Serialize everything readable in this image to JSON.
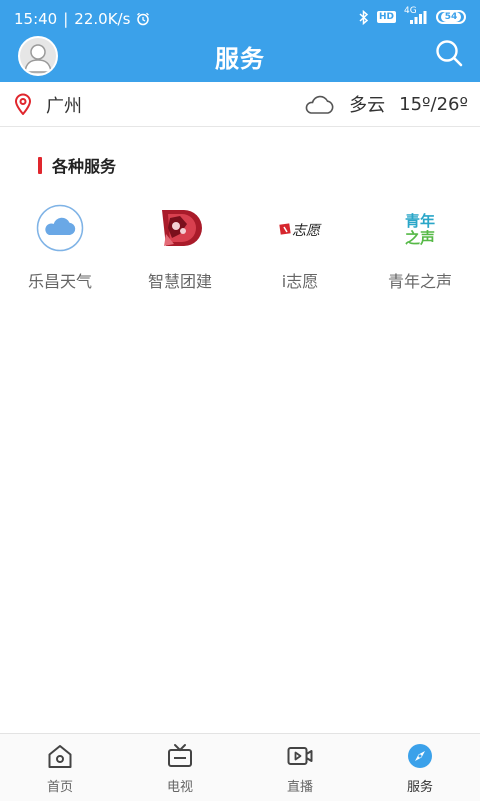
{
  "status_bar": {
    "time": "15:40",
    "separator": "|",
    "net_speed": "22.0K/s",
    "network": "4G",
    "hd_badge": "HD",
    "battery": "54",
    "alarm_icon": "alarm-icon",
    "bluetooth_icon": "bluetooth-icon",
    "signal_icon": "signal-icon"
  },
  "header": {
    "title": "服务",
    "avatar_icon": "user-avatar-icon",
    "search_icon": "search-icon",
    "background_color": "#3ba1ea"
  },
  "location": {
    "city": "广州",
    "location_icon": "location-pin-icon",
    "weather_icon": "cloud-icon",
    "weather": "多云",
    "temperature": "15º/26º"
  },
  "section": {
    "title": "各种服务",
    "accent_color": "#e0262d"
  },
  "services": [
    {
      "label": "乐昌天气",
      "icon": "weather-cloud-icon"
    },
    {
      "label": "智慧团建",
      "icon": "smart-league-logo-icon"
    },
    {
      "label": "i志愿",
      "icon": "volunteer-logo-icon",
      "logo_text": "志愿"
    },
    {
      "label": "青年之声",
      "icon": "youth-voice-logo-icon",
      "logo_text_top": "青年",
      "logo_text_bottom": "之声"
    }
  ],
  "tabbar": {
    "active_color": "#3ba1ea",
    "tabs": [
      {
        "label": "首页",
        "icon": "home-icon",
        "active": false
      },
      {
        "label": "电视",
        "icon": "tv-icon",
        "active": false
      },
      {
        "label": "直播",
        "icon": "live-video-icon",
        "active": false
      },
      {
        "label": "服务",
        "icon": "compass-icon",
        "active": true
      }
    ]
  }
}
